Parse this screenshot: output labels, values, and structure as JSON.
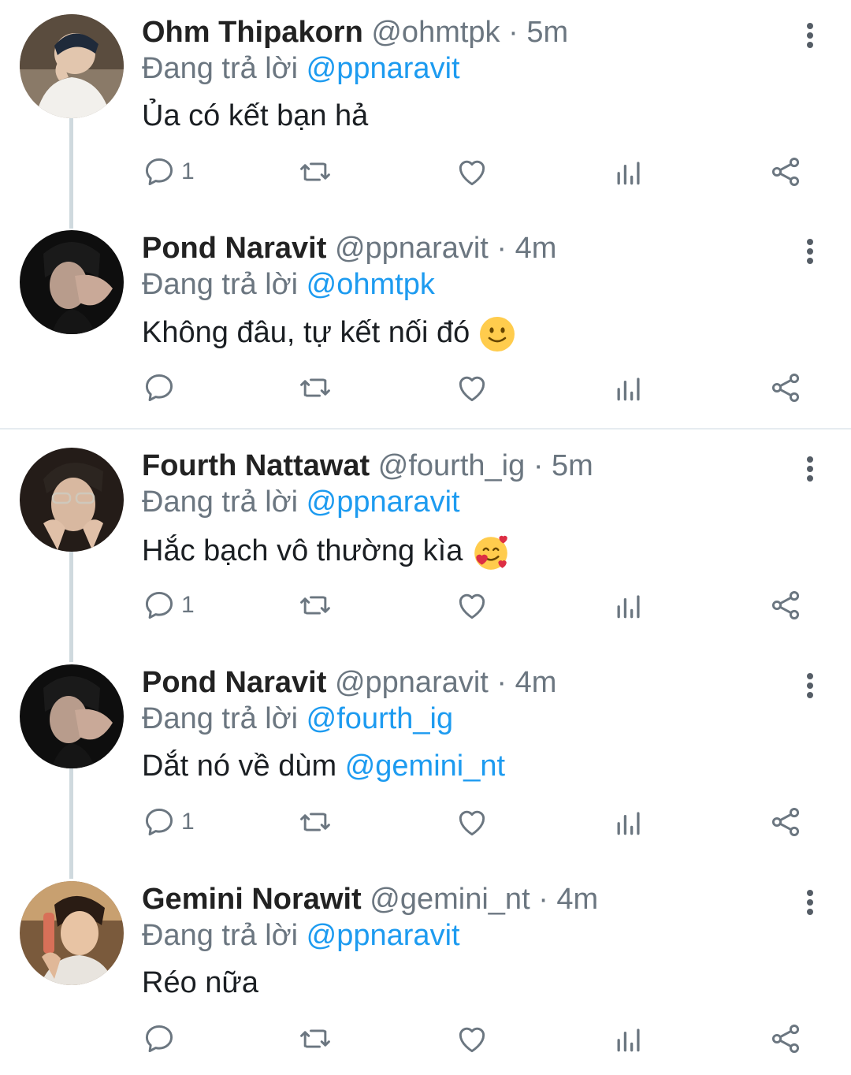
{
  "reply_prefix": "Đang trả lời",
  "tweets": [
    {
      "name": "Ohm Thipakorn",
      "handle": "@ohmtpk",
      "dot": "·",
      "time": "5m",
      "reply_to": "@ppnaravit",
      "text": "Ủa có kết bạn hả",
      "mention": "",
      "emoji": "",
      "reply_count": "1",
      "avatar": "user-photo"
    },
    {
      "name": "Pond Naravit",
      "handle": "@ppnaravit",
      "dot": "·",
      "time": "4m",
      "reply_to": "@ohmtpk",
      "text": "Không đâu, tự kết nối đó",
      "mention": "",
      "emoji": "slightly-smiling-face",
      "reply_count": "",
      "avatar": "user-photo"
    },
    {
      "name": "Fourth Nattawat",
      "handle": "@fourth_ig",
      "dot": "·",
      "time": "5m",
      "reply_to": "@ppnaravit",
      "text": "Hắc bạch vô thường kìa",
      "mention": "",
      "emoji": "smiling-face-with-hearts",
      "reply_count": "1",
      "avatar": "user-photo"
    },
    {
      "name": "Pond Naravit",
      "handle": "@ppnaravit",
      "dot": "·",
      "time": "4m",
      "reply_to": "@fourth_ig",
      "text": "Dắt nó về dùm",
      "mention": "@gemini_nt",
      "emoji": "",
      "reply_count": "1",
      "avatar": "user-photo"
    },
    {
      "name": "Gemini Norawit",
      "handle": "@gemini_nt",
      "dot": "·",
      "time": "4m",
      "reply_to": "@ppnaravit",
      "text": "Réo nữa",
      "mention": "",
      "emoji": "",
      "reply_count": "",
      "avatar": "user-photo"
    }
  ],
  "icons": {
    "reply": "reply-icon",
    "retweet": "retweet-icon",
    "like": "like-icon",
    "analytics": "analytics-icon",
    "share": "share-icon",
    "more": "more-icon"
  },
  "colors": {
    "accent": "#1d9bf0",
    "muted": "#6b7680",
    "divider": "#e6ecf0",
    "thread_line": "#cfd9de"
  }
}
